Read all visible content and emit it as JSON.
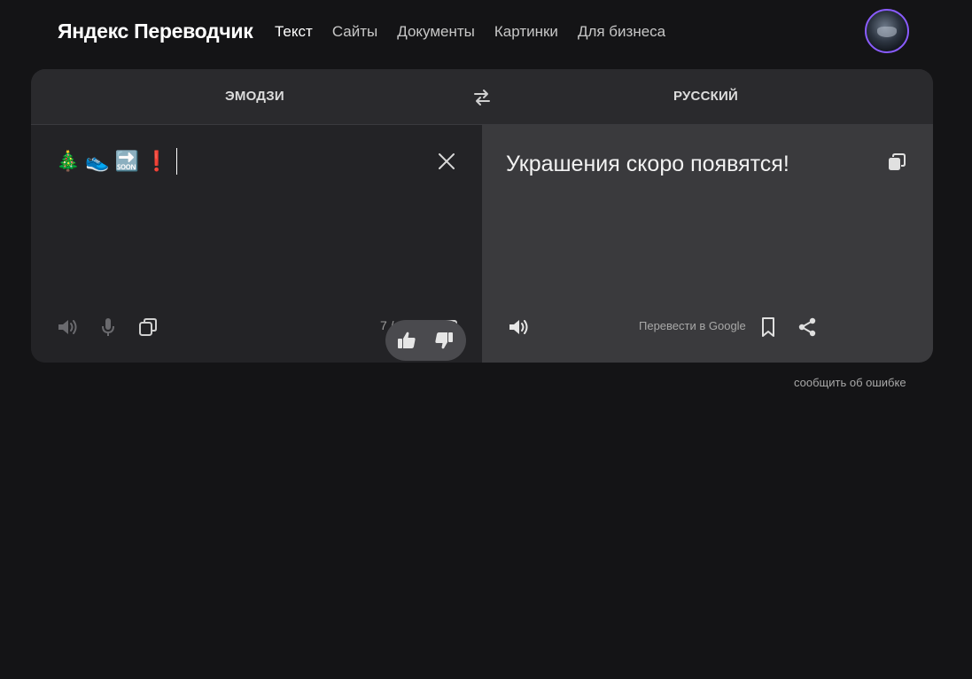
{
  "header": {
    "logo": "Яндекс Переводчик",
    "nav": [
      "Текст",
      "Сайты",
      "Документы",
      "Картинки",
      "Для бизнеса"
    ],
    "active_nav": "Текст"
  },
  "translator": {
    "source_lang": "ЭМОДЗИ",
    "target_lang": "РУССКИЙ",
    "input_text": "🎄👟🔜❗",
    "char_counter": "7 / 500",
    "translation": "Украшения скоро появятся!",
    "google_link": "Перевести в Google"
  },
  "footer": {
    "report_link": "сообщить об ошибке"
  },
  "icons": {
    "swap": "swap-arrows-icon",
    "clear": "close-icon",
    "speaker": "speaker-icon",
    "mic": "microphone-icon",
    "copy": "copy-icon",
    "keyboard": "keyboard-icon",
    "bookmark": "bookmark-icon",
    "share": "share-icon",
    "thumbs_up": "thumbs-up-icon",
    "thumbs_down": "thumbs-down-icon"
  },
  "colors": {
    "background": "#141416",
    "card": "#232326",
    "result_pane": "#3a3a3d",
    "avatar_ring": "#8a5cff"
  }
}
